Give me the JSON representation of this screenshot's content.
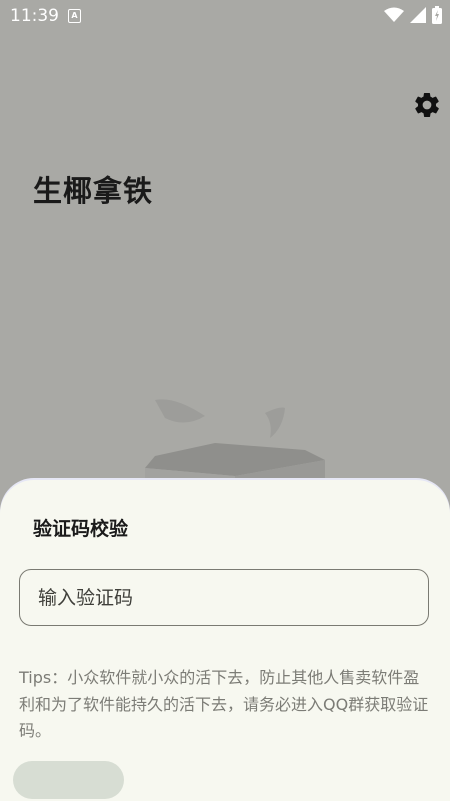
{
  "status_bar": {
    "time": "11:39",
    "notification_icon": "A"
  },
  "app": {
    "title": "生椰拿铁"
  },
  "icons": {
    "settings": "gear-icon"
  },
  "dialog": {
    "title": "验证码校验",
    "input_placeholder": "输入验证码",
    "tips": "Tips：小众软件就小众的活下去，防止其他人售卖软件盈利和为了软件能持久的活下去，请务必进入QQ群获取验证码。",
    "confirm_label": ""
  },
  "colors": {
    "background": "#a9a9a5",
    "sheet": "#f7f8f0",
    "button": "#d7ddd3"
  }
}
